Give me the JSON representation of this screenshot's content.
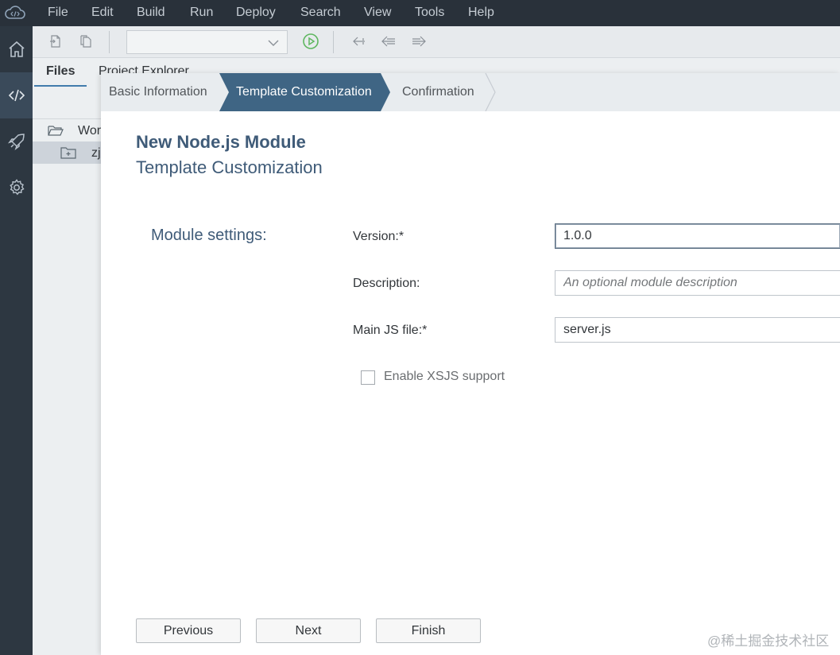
{
  "menubar": {
    "items": [
      "File",
      "Edit",
      "Build",
      "Run",
      "Deploy",
      "Search",
      "View",
      "Tools",
      "Help"
    ]
  },
  "activitybar": {
    "items": [
      {
        "icon": "home-icon"
      },
      {
        "icon": "code-icon",
        "active": true
      },
      {
        "icon": "rocket-icon"
      },
      {
        "icon": "gear-icon"
      }
    ]
  },
  "toolbar": {
    "run_config_value": ""
  },
  "panel": {
    "tabs": [
      "Files",
      "Project Explorer"
    ],
    "tree": [
      {
        "label": "Wor",
        "icon": "folder-open-icon"
      },
      {
        "label": "zj",
        "icon": "module-folder-icon",
        "selected": true
      }
    ]
  },
  "wizard": {
    "steps": [
      "Basic Information",
      "Template Customization",
      "Confirmation"
    ],
    "active_step": 1,
    "title": "New Node.js Module",
    "subtitle": "Template Customization",
    "section_label": "Module settings:",
    "fields": {
      "version": {
        "label": "Version:*",
        "value": "1.0.0"
      },
      "description": {
        "label": "Description:",
        "value": "",
        "placeholder": "An optional module description"
      },
      "main_js": {
        "label": "Main JS file:*",
        "value": "server.js"
      }
    },
    "xsjs": {
      "label": "Enable XSJS support",
      "checked": false
    },
    "buttons": {
      "previous": "Previous",
      "next": "Next",
      "finish": "Finish"
    }
  },
  "watermark": "@稀土掘金技术社区",
  "colors": {
    "menubar_bg": "#29313a",
    "activitybar_bg": "#2d3741",
    "accent": "#3f5b78",
    "active_step_bg": "#3f6584",
    "run_green": "#5fb760"
  }
}
